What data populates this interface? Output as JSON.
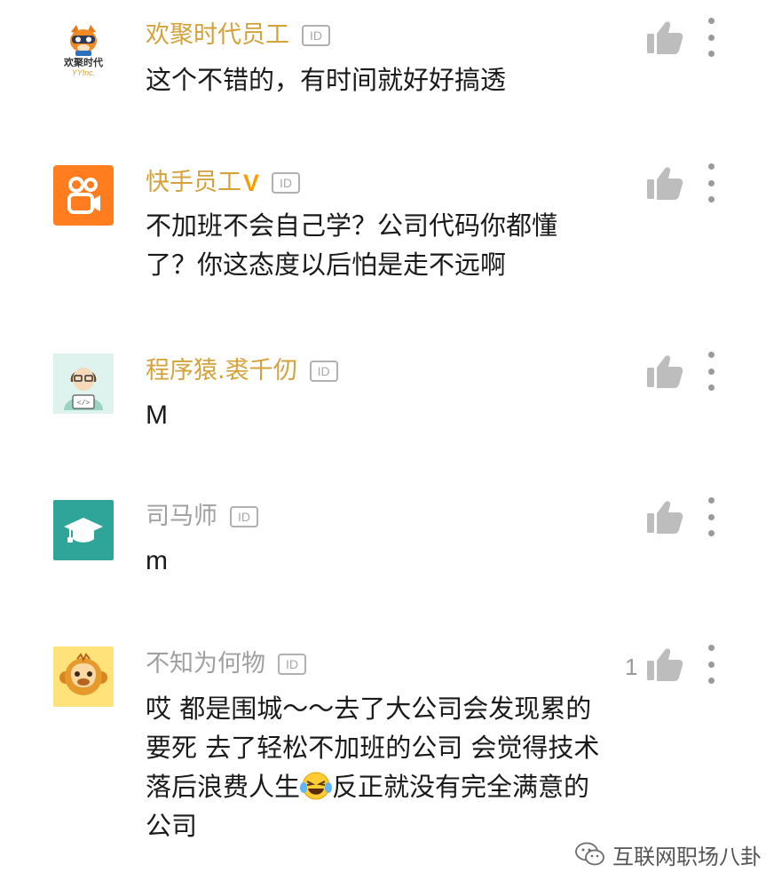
{
  "colors": {
    "vip_name": "#d4a23a",
    "normal_name": "#a0a0a0",
    "text": "#1a1a1a",
    "icon_gray": "#9a9a9a",
    "v_badge": "#f5a000"
  },
  "comments": [
    {
      "user": "欢聚时代员工",
      "id_badge": "ID",
      "avatar_icon": "yy-company-logo-avatar",
      "avatar_caption": "欢聚时代",
      "avatar_caption_sub": "YYInc.",
      "text": "这个不错的，有时间就好好搞透"
    },
    {
      "user": "快手员工",
      "verified_badge": "V",
      "id_badge": "ID",
      "avatar_icon": "kuaishou-logo-avatar",
      "text_lines": [
        "不加班不会自己学？公司代码你都懂",
        "了？你这态度以后怕是走不远啊"
      ]
    },
    {
      "user": "程序猿.裘千仞",
      "id_badge": "ID",
      "avatar_icon": "programmer-avatar",
      "text": "M"
    },
    {
      "user": "司马师",
      "id_badge": "ID",
      "avatar_icon": "graduation-cap-avatar",
      "text": "m"
    },
    {
      "user": "不知为何物",
      "id_badge": "ID",
      "avatar_icon": "monkey-avatar",
      "like_count": "1",
      "text_lines": [
        "哎 都是围城～～去了大公司会发现累的",
        "要死 去了轻松不加班的公司 会觉得技术",
        "落后浪费人生",
        "反正就没有完全满意的",
        "公司"
      ],
      "emoji": "laughing-tears-emoji"
    }
  ],
  "watermark": {
    "text": "互联网职场八卦",
    "icon": "wechat-icon"
  }
}
